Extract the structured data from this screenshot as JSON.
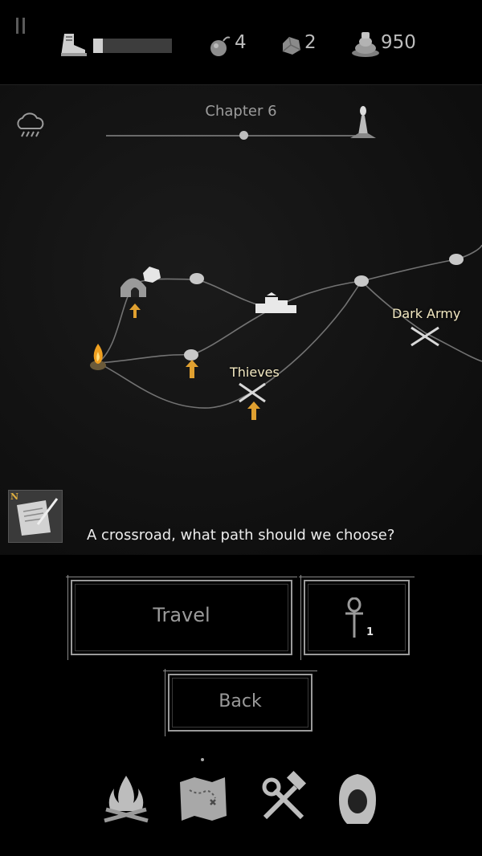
{
  "status": {
    "stamina_fraction": 0.12,
    "bombs": "4",
    "stones": "2",
    "gold": "950"
  },
  "chapter": {
    "title": "Chapter 6",
    "progress": 0.55
  },
  "map": {
    "locations": [
      {
        "label": "Thieves"
      },
      {
        "label": "Dark Army"
      }
    ],
    "message": "A crossroad, what path should we choose?",
    "journal_badge": "N"
  },
  "actions": {
    "travel_label": "Travel",
    "ankh_count": "1",
    "back_label": "Back"
  },
  "icons": {
    "boot": "boot-icon",
    "bomb": "bomb-icon",
    "stone": "stone-icon",
    "gold": "gold-pile-icon",
    "weather": "rain-cloud-icon",
    "ankh": "ankh-icon",
    "campfire": "campfire-icon",
    "map": "treasure-map-icon",
    "crafting": "hammer-wrench-icon",
    "character": "hooded-figure-icon"
  }
}
